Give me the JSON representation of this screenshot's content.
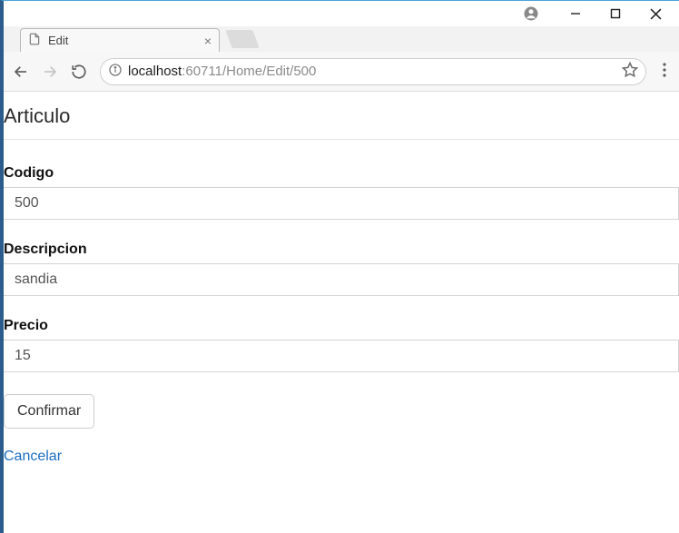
{
  "window": {
    "tab_title": "Edit"
  },
  "address": {
    "host": "localhost",
    "rest": ":60711/Home/Edit/500"
  },
  "page": {
    "heading": "Articulo",
    "fields": {
      "codigo": {
        "label": "Codigo",
        "value": "500"
      },
      "descripcion": {
        "label": "Descripcion",
        "value": "sandia"
      },
      "precio": {
        "label": "Precio",
        "value": "15"
      }
    },
    "submit_label": "Confirmar",
    "cancel_label": "Cancelar"
  }
}
